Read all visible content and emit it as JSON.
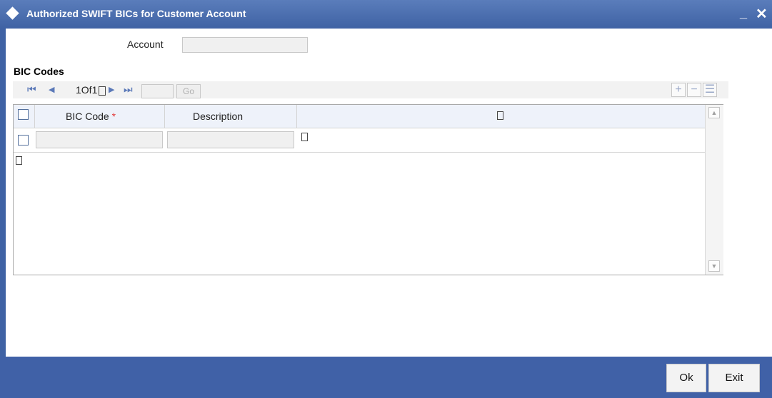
{
  "window": {
    "title": "Authorized SWIFT BICs for Customer Account",
    "minimize_glyph": "_",
    "close_glyph": "✕"
  },
  "account": {
    "label": "Account",
    "value": ""
  },
  "section": {
    "title": "BIC Codes"
  },
  "pager": {
    "first_glyph": "⏮",
    "prev_glyph": "◀",
    "page_text": "1Of1",
    "next_glyph": "▶",
    "last_glyph": "⏭",
    "page_input": "",
    "go_label": "Go",
    "add_glyph": "+",
    "remove_glyph": "−",
    "view_glyph": "☰"
  },
  "grid": {
    "columns": [
      "BIC Code",
      "Description"
    ],
    "required_marker": "*",
    "rows": [
      {
        "bic_code": "",
        "description": ""
      }
    ],
    "scroll_up_glyph": "▲",
    "scroll_down_glyph": "▼"
  },
  "footer": {
    "ok_label": "Ok",
    "exit_label": "Exit"
  },
  "colors": {
    "titlebar": "#4a6db0",
    "footer": "#4061a7",
    "required": "#e23a3a"
  }
}
